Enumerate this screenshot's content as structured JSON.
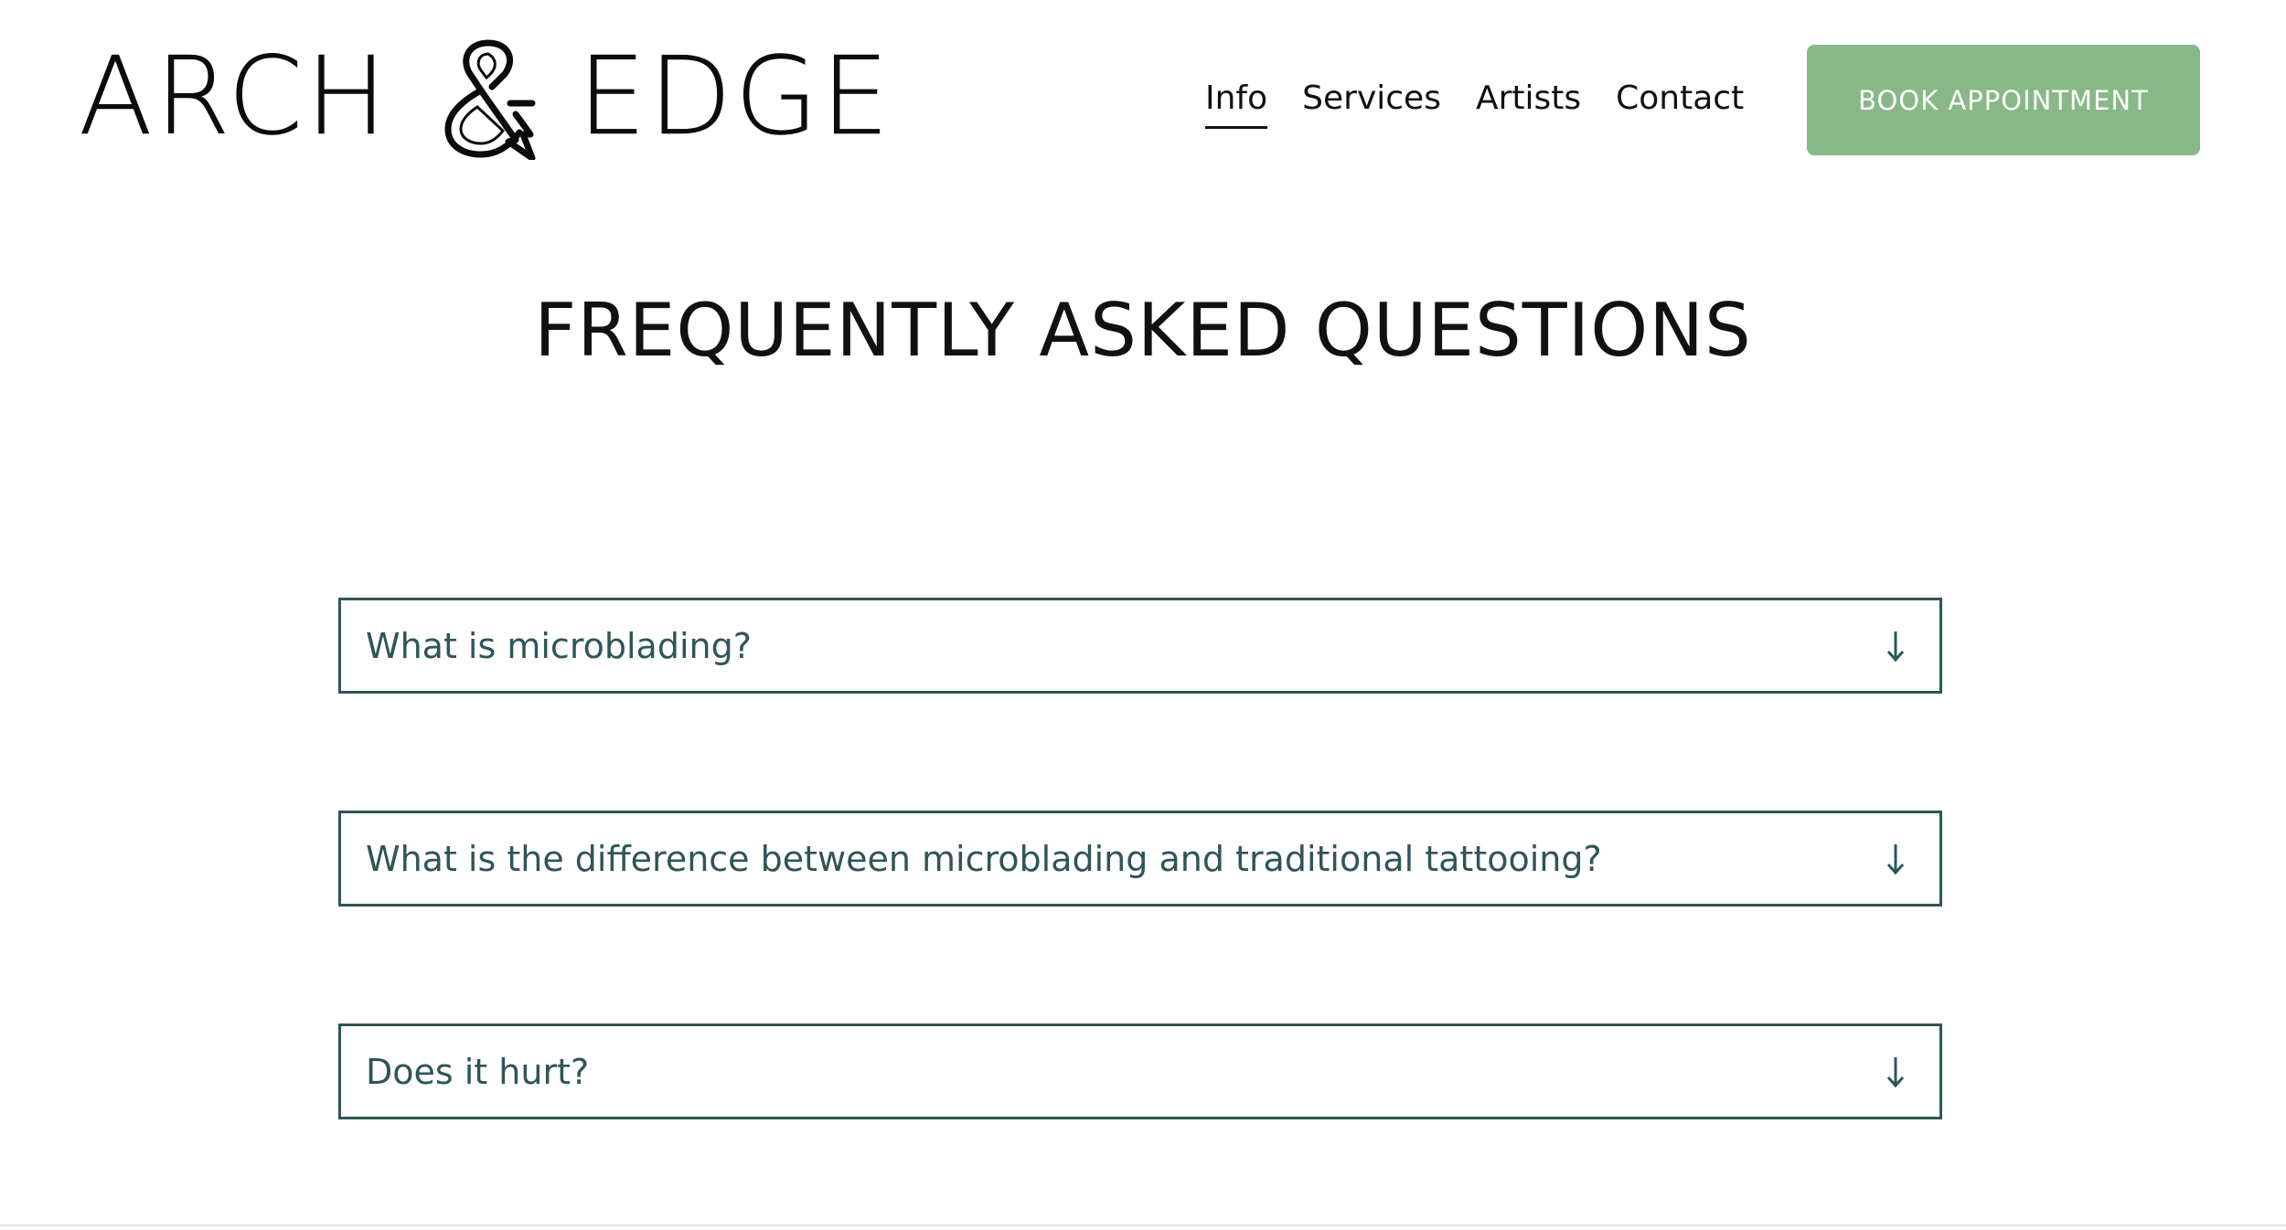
{
  "header": {
    "logo": {
      "word_left": "ARCH",
      "ampersand": "&",
      "word_right": "EDGE"
    },
    "nav": [
      {
        "label": "Info",
        "active": true
      },
      {
        "label": "Services",
        "active": false
      },
      {
        "label": "Artists",
        "active": false
      },
      {
        "label": "Contact",
        "active": false
      }
    ],
    "book_button": "BOOK APPOINTMENT",
    "book_button_color": "#88b888"
  },
  "faq": {
    "title": "FREQUENTLY ASKED QUESTIONS",
    "accent_color": "#2f5558",
    "items": [
      {
        "question": "What is microblading?",
        "icon": "arrow-down-icon"
      },
      {
        "question": "What is the difference between microblading and traditional tattooing?",
        "icon": "arrow-down-icon"
      },
      {
        "question": "Does it hurt?",
        "icon": "arrow-down-icon"
      }
    ]
  }
}
